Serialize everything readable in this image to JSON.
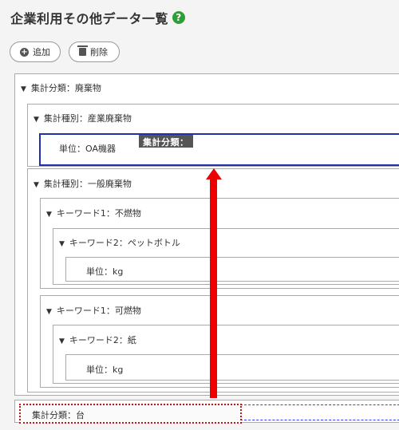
{
  "header": {
    "title": "企業利用その他データ一覧",
    "help_icon": "?"
  },
  "toolbar": {
    "add_label": "追加",
    "delete_label": "削除"
  },
  "tree": {
    "group1": "集計分類：廃棄物",
    "type1": "集計種別：産業廃棄物",
    "unit1": "単位：OA機器",
    "type2": "集計種別：一般廃棄物",
    "kw1a": "キーワード1：不燃物",
    "kw2a": "キーワード2：ペットボトル",
    "unit2": "単位：kg",
    "kw1b": "キーワード1：可燃物",
    "kw2b": "キーワード2：紙",
    "unit3": "単位：kg",
    "group2": "集計分類：台"
  },
  "drag": {
    "tooltip": "集計分類："
  },
  "colors": {
    "arrow": "#ee0000",
    "selection": "#1f2fb0",
    "help": "#2e9e3a"
  }
}
